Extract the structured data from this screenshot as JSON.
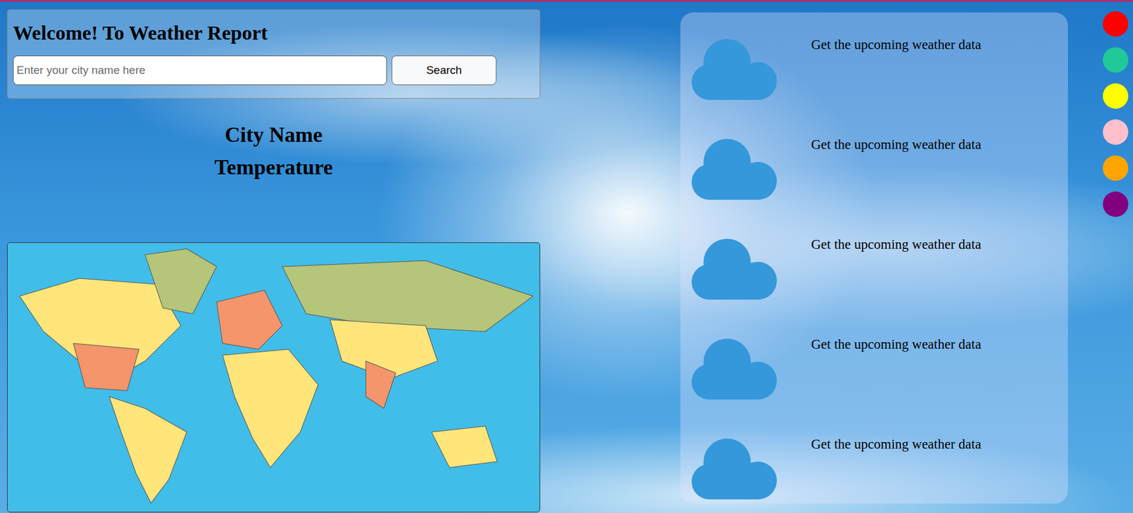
{
  "header": {
    "title": "Welcome! To Weather Report"
  },
  "search": {
    "placeholder": "Enter your city name here",
    "button": "Search"
  },
  "current": {
    "city": "City Name",
    "temperature": "Temperature"
  },
  "forecast": [
    {
      "text": "Get the upcoming weather data"
    },
    {
      "text": "Get the upcoming weather data"
    },
    {
      "text": "Get the upcoming weather data"
    },
    {
      "text": "Get the upcoming weather data"
    },
    {
      "text": "Get the upcoming weather data"
    }
  ],
  "theme_dots": [
    {
      "color": "#ff0000"
    },
    {
      "color": "#20c997"
    },
    {
      "color": "#ffff00"
    },
    {
      "color": "#ffc0cb"
    },
    {
      "color": "#ffa500"
    },
    {
      "color": "#800080"
    }
  ]
}
